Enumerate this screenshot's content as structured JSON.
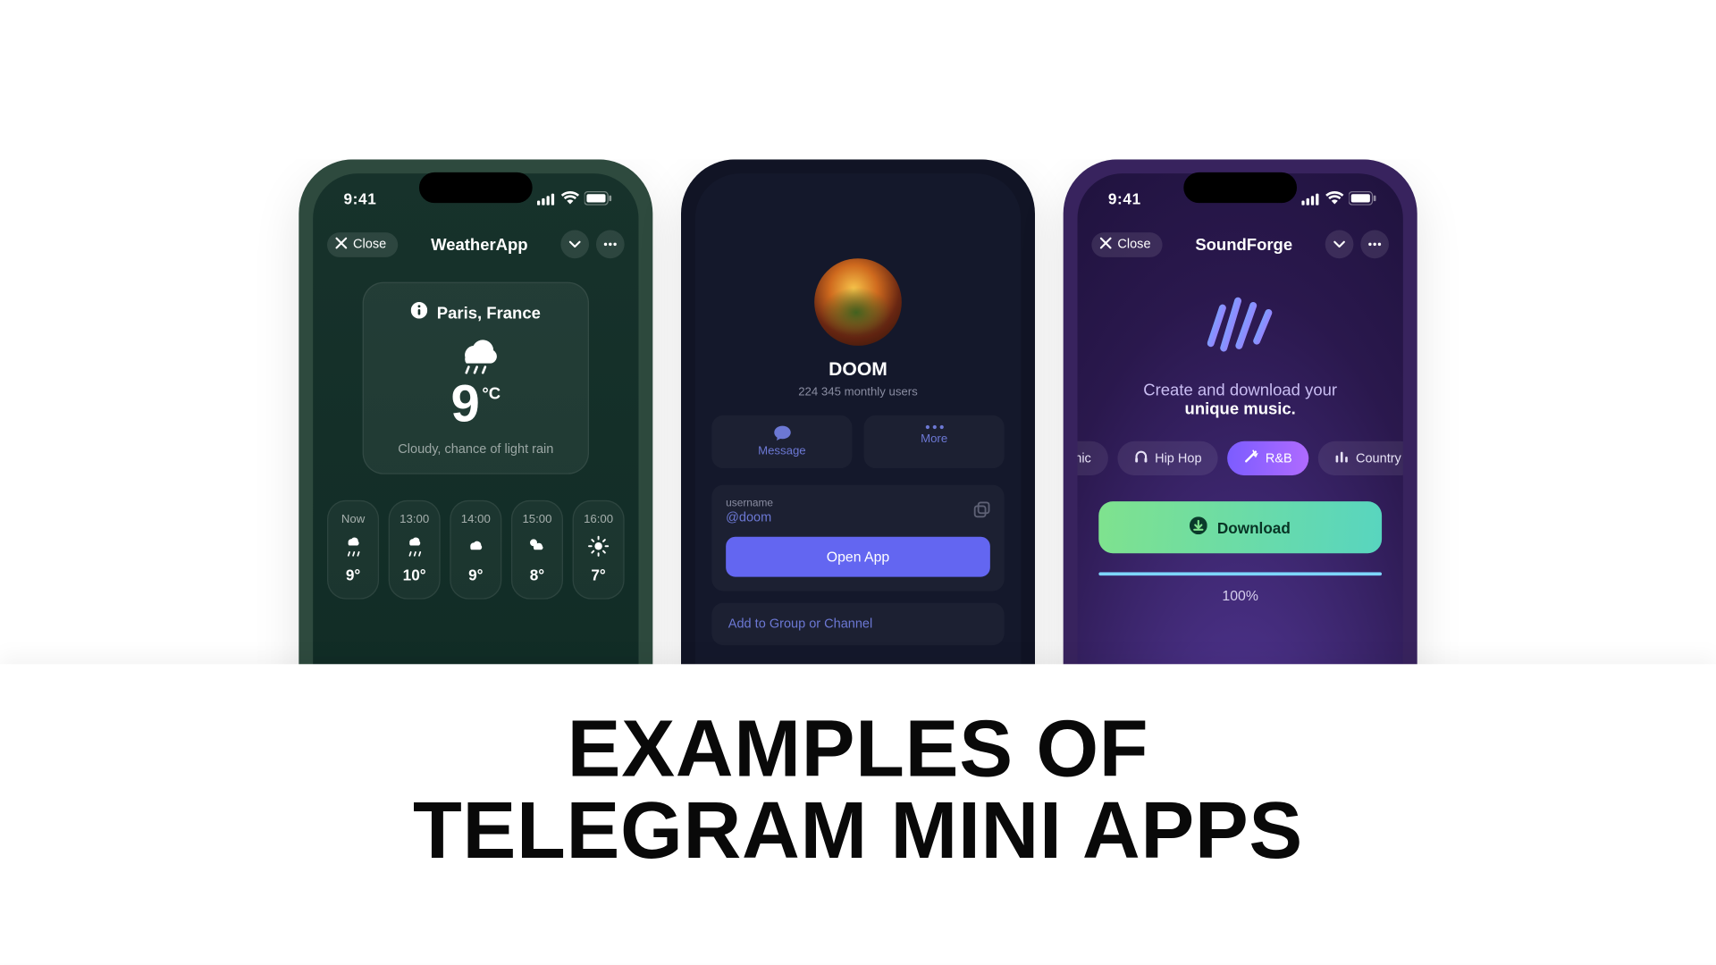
{
  "status": {
    "time": "9:41"
  },
  "close_label": "Close",
  "weather": {
    "title": "WeatherApp",
    "location": "Paris, France",
    "temp": "9",
    "unit": "°C",
    "desc": "Cloudy, chance of light rain",
    "forecast": [
      {
        "t": "Now",
        "v": "9°",
        "icon": "rain"
      },
      {
        "t": "13:00",
        "v": "10°",
        "icon": "rain"
      },
      {
        "t": "14:00",
        "v": "9°",
        "icon": "cloud"
      },
      {
        "t": "15:00",
        "v": "8°",
        "icon": "partly"
      },
      {
        "t": "16:00",
        "v": "7°",
        "icon": "sun"
      }
    ]
  },
  "doom": {
    "name": "DOOM",
    "monthly": "224 345 monthly users",
    "message_label": "Message",
    "more_label": "More",
    "username_field": "username",
    "handle": "@doom",
    "open_app": "Open App",
    "add_to": "Add to Group or Channel"
  },
  "sound": {
    "title": "SoundForge",
    "tagline_pre": "Create and download your",
    "tagline_bold": "unique music.",
    "genres": [
      {
        "label": "nic",
        "icon": "wave",
        "active": false,
        "clip": "left"
      },
      {
        "label": "Hip Hop",
        "icon": "head",
        "active": false
      },
      {
        "label": "R&B",
        "icon": "wand",
        "active": true
      },
      {
        "label": "Country",
        "icon": "eq",
        "active": false,
        "clip": "right"
      }
    ],
    "download_label": "Download",
    "progress": {
      "pct": 100,
      "label": "100%"
    }
  },
  "headline_l1": "EXAMPLES OF",
  "headline_l2": "TELEGRAM MINI APPS"
}
